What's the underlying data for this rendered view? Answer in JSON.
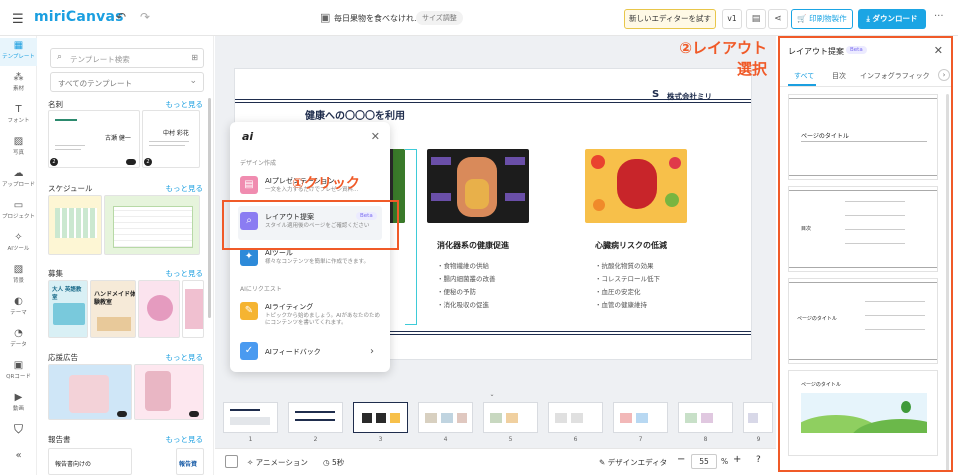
{
  "topbar": {
    "menu_icon": "hamburger-icon",
    "logo": "miriCanvas",
    "doc_title": "毎日果物を食べなけれ...",
    "size_chip": "サイズ調整",
    "try_editor": "新しいエディターを試す",
    "version": "v1",
    "print_label": "印刷物製作",
    "download_label": "ダウンロード"
  },
  "rail": {
    "items": [
      {
        "label": "テンプレート",
        "icon": "template-icon"
      },
      {
        "label": "素材",
        "icon": "elements-icon"
      },
      {
        "label": "フォント",
        "icon": "text-icon"
      },
      {
        "label": "写真",
        "icon": "photo-icon"
      },
      {
        "label": "アップロード",
        "icon": "upload-icon"
      },
      {
        "label": "プロジェクト",
        "icon": "folder-icon"
      },
      {
        "label": "AIツール",
        "icon": "ai-tool-icon"
      },
      {
        "label": "背景",
        "icon": "background-icon"
      },
      {
        "label": "テーマ",
        "icon": "theme-icon"
      },
      {
        "label": "データ",
        "icon": "data-icon"
      },
      {
        "label": "QRコード",
        "icon": "qr-icon"
      },
      {
        "label": "動画",
        "icon": "video-icon"
      }
    ]
  },
  "templates": {
    "search_placeholder": "テンプレート検索",
    "filter_value": "すべてのテンプレート",
    "more": "もっと見る",
    "sections": [
      "名刺",
      "スケジュール",
      "募集",
      "応援広告",
      "報告書"
    ],
    "card_names": [
      "古瀬 健一",
      "中村 彩花"
    ],
    "flyer_texts": [
      "大人 英語教室",
      "ハンドメイド体験教室",
      "報告資"
    ],
    "report_text": "報告書向けの"
  },
  "slide": {
    "company": "株式会社ミリ",
    "heading": "健康への〇〇〇を利用",
    "cards": [
      {
        "title": "消化器系の健康促進",
        "bullets": [
          "・食物繊維の供給",
          "・腸内細菌叢の改善",
          "・便秘の予防",
          "・消化吸収の促進"
        ]
      },
      {
        "title": "心臓病リスクの低減",
        "bullets": [
          "・抗酸化物質の効果",
          "・コレステロール低下",
          "・血圧の安定化",
          "・血管の健康維持"
        ]
      }
    ]
  },
  "ai_popup": {
    "logo": "ai",
    "section_design": "デザイン作成",
    "items": [
      {
        "name": "AIプレゼンテーション",
        "desc": "一文を入力するだけでプレゼン資料..."
      },
      {
        "name": "レイアウト提案",
        "desc": "スタイル適用後のページをご確認ください",
        "beta": "Beta"
      },
      {
        "name": "AIツール",
        "desc": "様々なコンテンツを簡単に作成できます。"
      }
    ],
    "section_request": "AIにリクエスト",
    "req_items": [
      {
        "name": "AIライティング",
        "desc": "トピックから始めましょう。AIがあなたのためにコンテンツを書いてくれます。"
      },
      {
        "name": "AIフィードバック",
        "desc": ""
      }
    ]
  },
  "annotations": {
    "click": "①クリック",
    "layout_line1": "②レイアウト",
    "layout_line2": "選択"
  },
  "filmstrip": {
    "pages": [
      "1",
      "2",
      "3",
      "4",
      "5",
      "6",
      "7",
      "8",
      "9"
    ],
    "active": 3
  },
  "bottombar": {
    "animation": "アニメーション",
    "duration": "5秒",
    "design_editor": "デザインエディタ",
    "zoom": "55",
    "zoom_unit": "%"
  },
  "layout_panel": {
    "title": "レイアウト提案",
    "beta": "Beta",
    "tabs": [
      "すべて",
      "目次",
      "インフォグラフィック"
    ],
    "cards": [
      {
        "title": "ページのタイトル"
      },
      {
        "title": "目次"
      },
      {
        "title": "ページのタイトル"
      },
      {
        "title": "ページのタイトル"
      }
    ]
  },
  "colors": {
    "accent": "#1b9fe0",
    "annotation": "#f05a28",
    "navy": "#1f2d4d"
  }
}
